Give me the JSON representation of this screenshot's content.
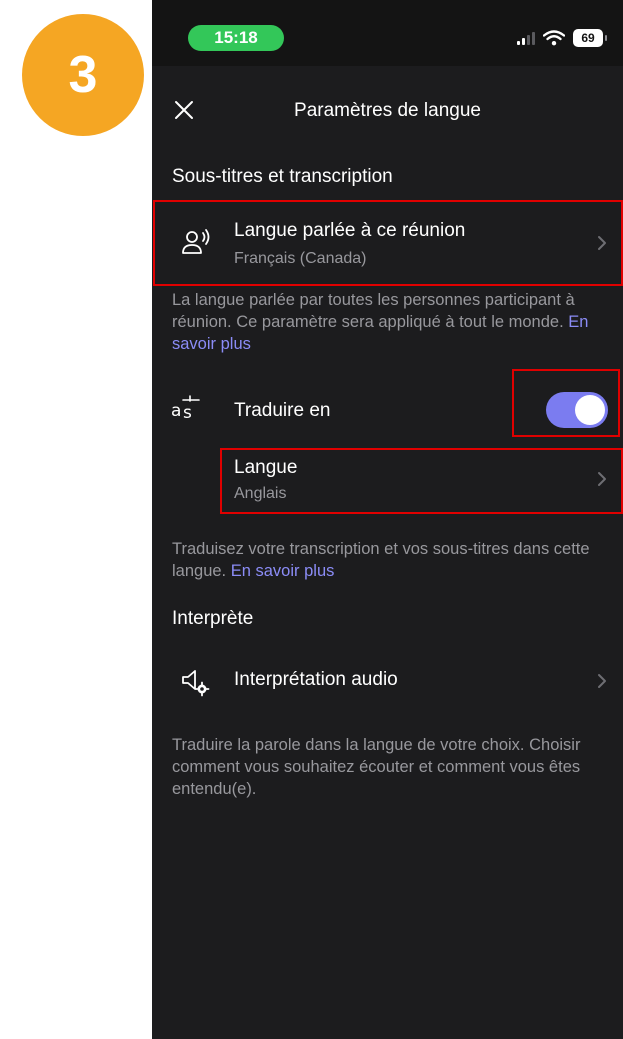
{
  "step_badge": "3",
  "status_bar": {
    "time": "15:18",
    "battery": "69"
  },
  "header": {
    "title": "Paramètres de langue"
  },
  "captions_section": {
    "title": "Sous-titres et transcription",
    "spoken_language": {
      "label": "Langue parlée à ce réunion",
      "value": "Français (Canada)"
    },
    "spoken_description": "La langue parlée par toutes les personnes participant à réunion. Ce paramètre sera appliqué à tout le monde.",
    "learn_more_1": "En savoir plus",
    "translate": {
      "label": "Traduire en",
      "enabled": true
    },
    "language": {
      "label": "Langue",
      "value": "Anglais"
    },
    "translate_description": "Traduisez votre transcription et vos sous-titres dans cette langue.",
    "learn_more_2": "En savoir plus"
  },
  "interpreter_section": {
    "title": "Interprète",
    "audio_interpretation": {
      "label": "Interprétation audio"
    },
    "description": "Traduire la parole dans la langue de votre choix. Choisir comment vous souhaitez écouter et comment vous êtes entendu(e)."
  },
  "colors": {
    "background": "#1c1c1e",
    "accent": "#7b7cf0",
    "link": "#8b8cf6",
    "time_pill": "#33c759",
    "step_badge": "#f5a623",
    "highlight": "#e00000"
  }
}
